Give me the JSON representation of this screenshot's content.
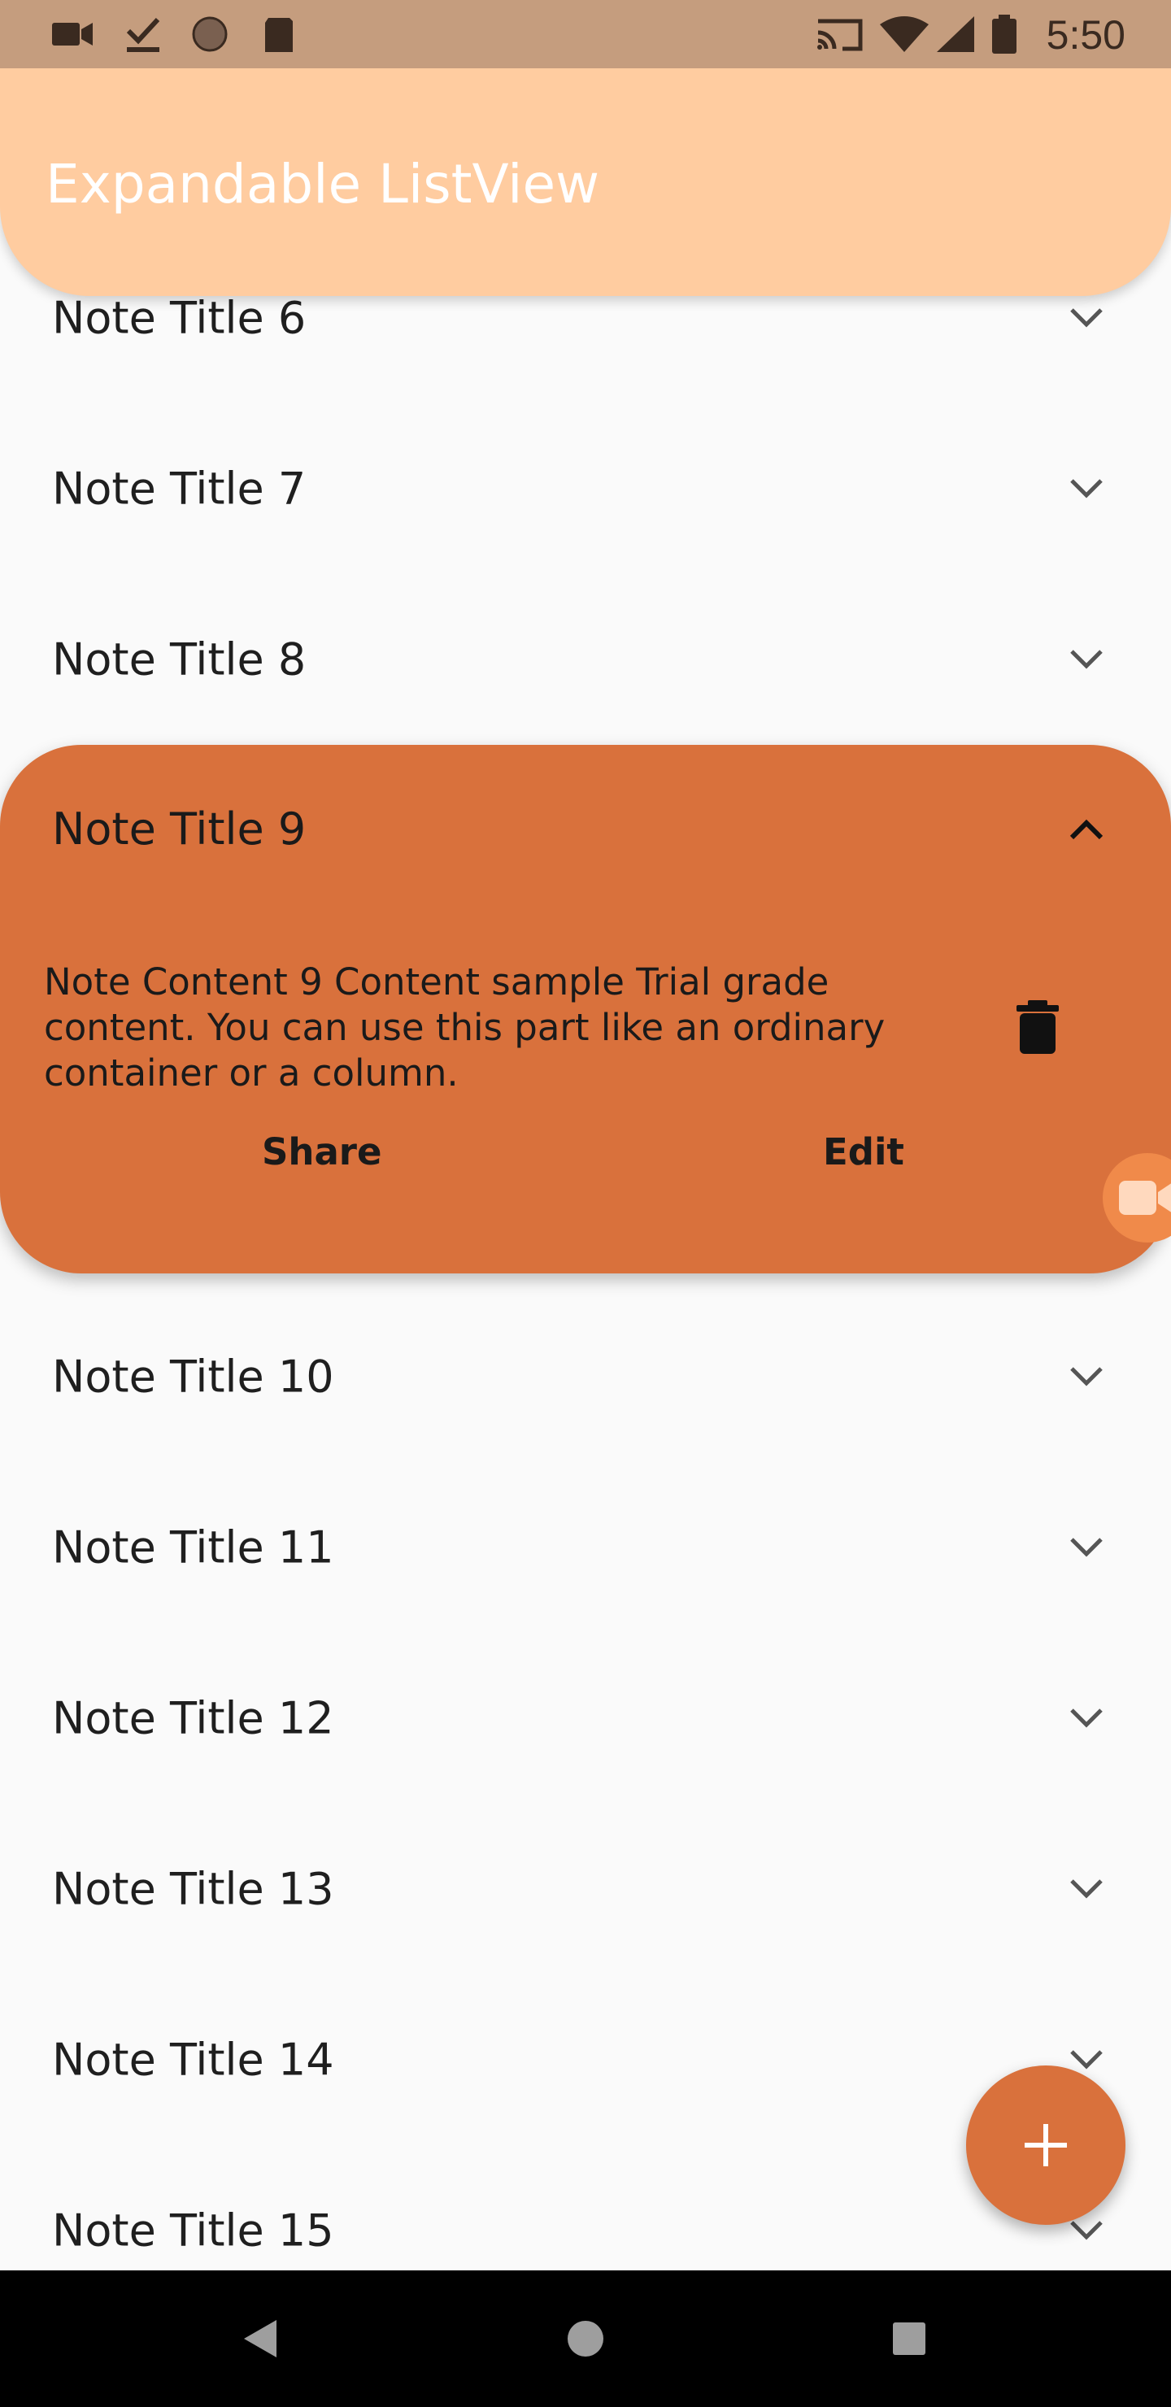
{
  "status_bar": {
    "time": "5:50",
    "left_icons": [
      "video-camera-icon",
      "download-done-icon",
      "sync-circle-icon",
      "sd-card-icon"
    ],
    "right_icons": [
      "cast-icon",
      "wifi-icon",
      "signal-icon",
      "battery-icon"
    ]
  },
  "app_bar": {
    "title": "Expandable ListView",
    "color": "#ffcca0"
  },
  "list": {
    "items_above": [
      "Note Title 6",
      "Note Title 7",
      "Note Title 8"
    ],
    "expanded": {
      "title": "Note Title 9",
      "content": "Note Content 9 Content sample Trial grade content. You can use this part like an ordinary container or a column.",
      "share_label": "Share",
      "edit_label": "Edit",
      "color": "#d9713c"
    },
    "items_below": [
      "Note Title 10",
      "Note Title 11",
      "Note Title 12",
      "Note Title 13",
      "Note Title 14",
      "Note Title 15"
    ]
  },
  "fab": {
    "icon": "plus-icon",
    "color": "#d9713c"
  },
  "nav_bar": {
    "icons": [
      "back-icon",
      "home-icon",
      "recents-icon"
    ]
  }
}
